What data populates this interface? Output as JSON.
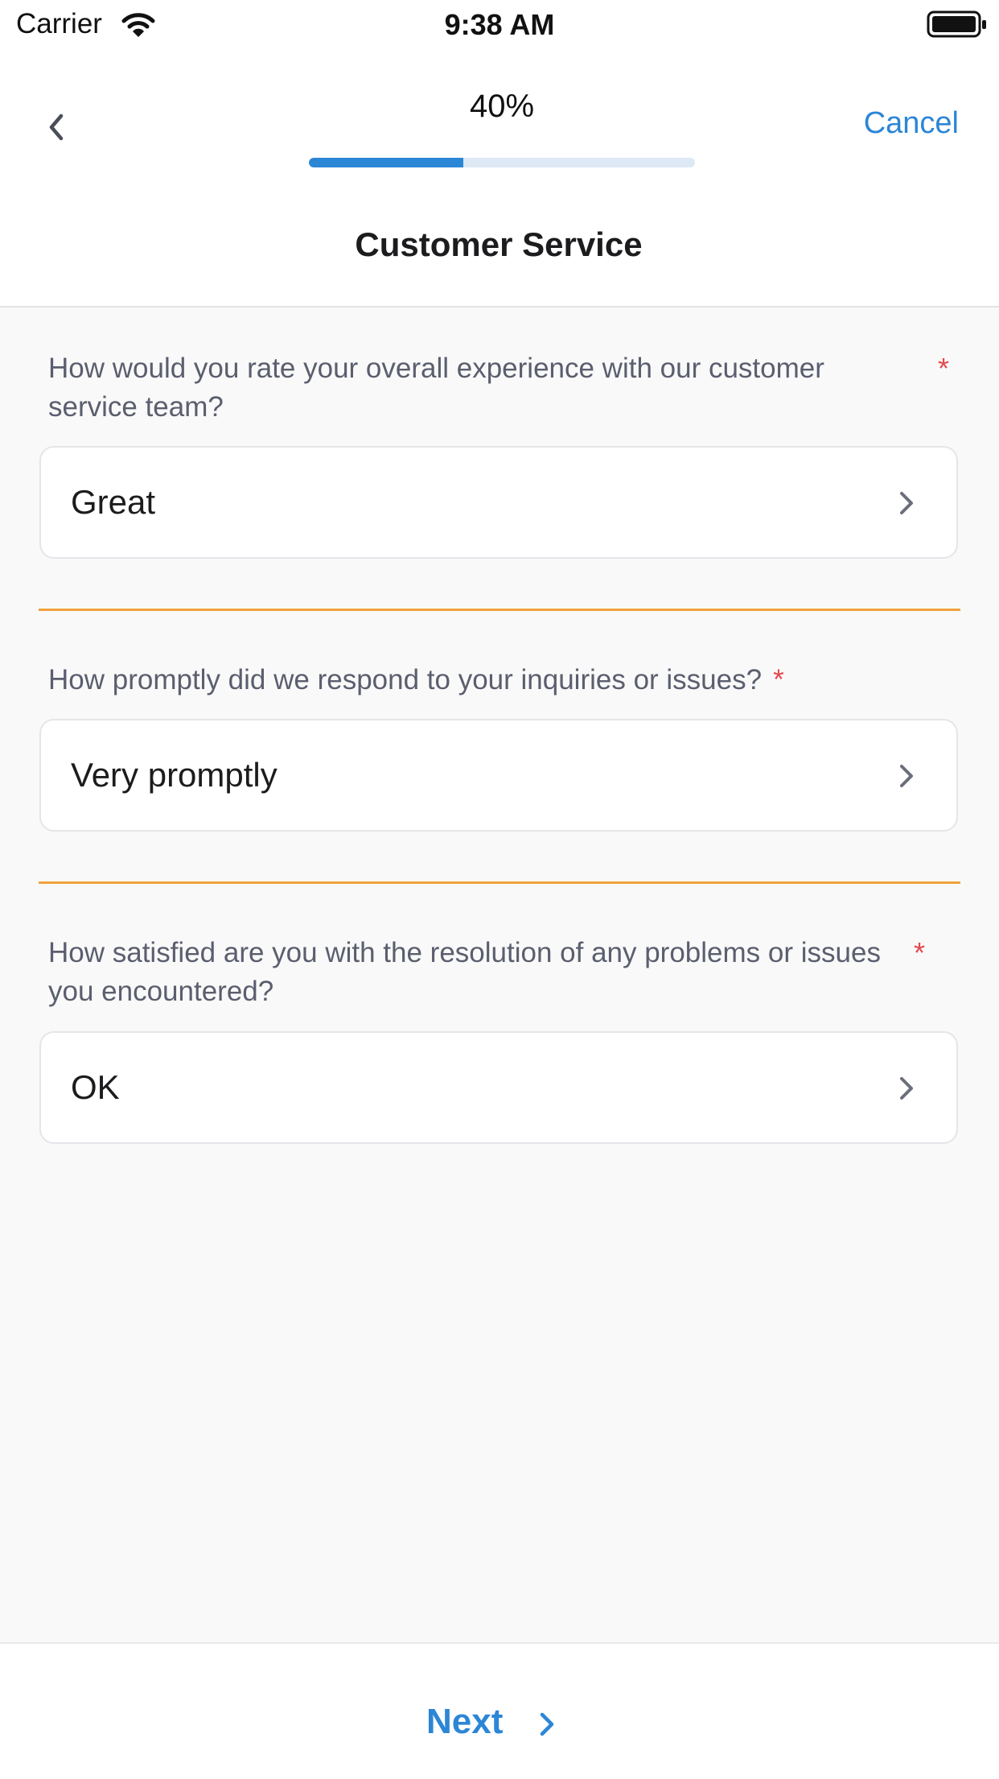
{
  "status_bar": {
    "carrier": "Carrier",
    "time": "9:38 AM",
    "wifi_icon": "wifi-icon",
    "battery_icon": "battery-icon"
  },
  "header": {
    "back_icon": "chevron-left-icon",
    "progress_text": "40%",
    "progress_value": 0.4,
    "cancel_label": "Cancel",
    "title": "Customer Service"
  },
  "questions": [
    {
      "text": "How would you rate your overall experience with our customer service team?",
      "required_mark": "*",
      "answer": "Great",
      "chevron_icon": "chevron-right-icon"
    },
    {
      "text": "How promptly did we respond to your inquiries or issues?",
      "required_mark": "*",
      "answer": "Very promptly",
      "chevron_icon": "chevron-right-icon"
    },
    {
      "text": "How satisfied are you with the resolution of any problems or issues you encountered?",
      "required_mark": "*",
      "answer": "OK",
      "chevron_icon": "chevron-right-icon"
    }
  ],
  "footer": {
    "next_label": "Next",
    "next_icon": "chevron-right-icon"
  },
  "colors": {
    "accent": "#2c86d6",
    "progress_track": "#dde9f5",
    "required": "#e5484d",
    "divider": "#f0a23c",
    "question_text": "#5a5e6e",
    "background": "#f9f9f9"
  }
}
